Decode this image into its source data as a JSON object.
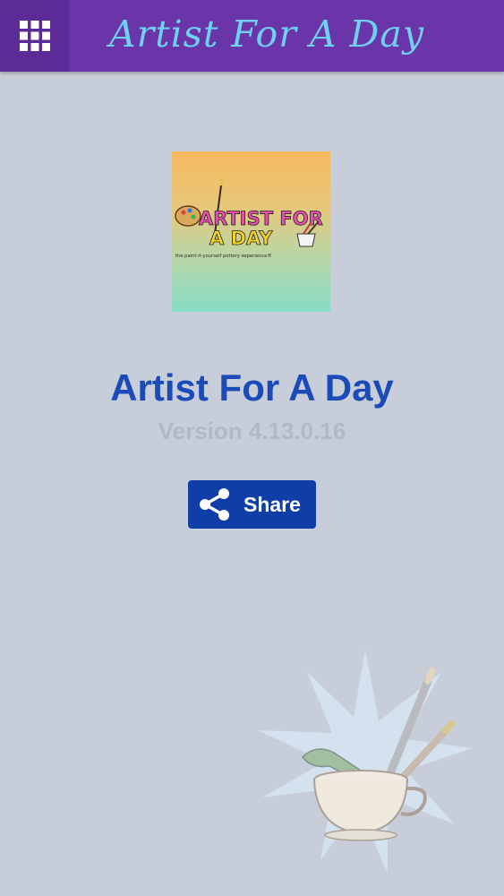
{
  "header": {
    "title": "Artist For A Day",
    "menu_icon": "grid-menu-icon"
  },
  "about": {
    "logo_text_line1": "ARTIST FOR",
    "logo_text_line2": "A DAY",
    "logo_tagline": "the paint-it-yourself pottery experience®",
    "app_name": "Artist For A Day",
    "version": "Version 4.13.0.16"
  },
  "actions": {
    "share_label": "Share",
    "share_icon": "share-icon"
  },
  "decor": {
    "watermark_icon": "paint-cup-brushes-icon"
  },
  "colors": {
    "header_bg": "#6a35a8",
    "page_bg": "#c8ced9",
    "title_blue": "#1a4bb8",
    "button_blue": "#0f3ea8",
    "script_title": "#6fd0f0"
  }
}
